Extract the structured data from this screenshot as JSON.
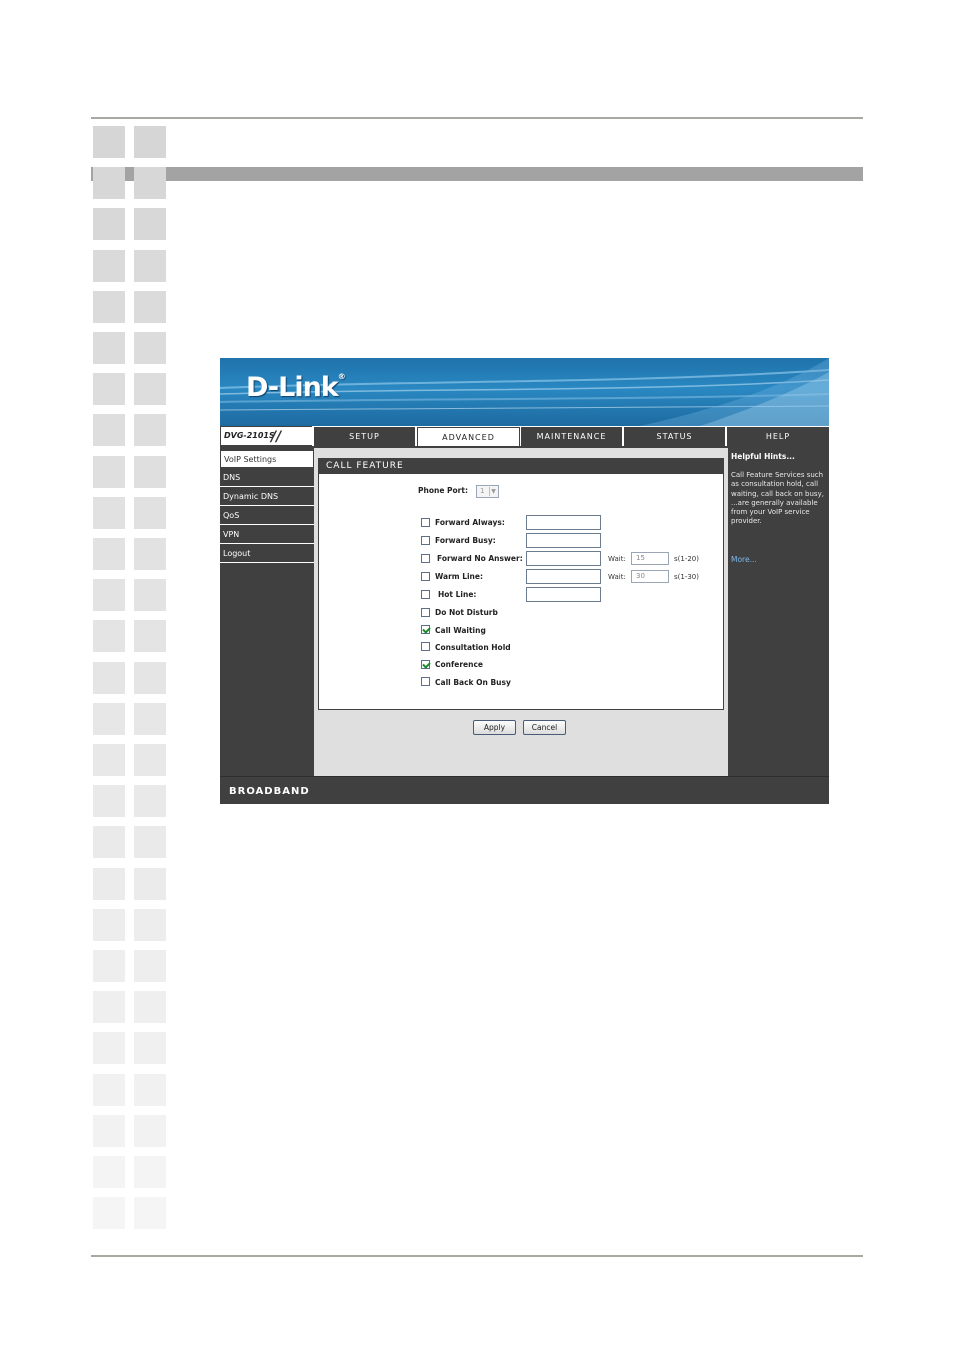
{
  "app": {
    "logo": "D-Link",
    "logo_mark": "®",
    "model": "DVG-2101S",
    "model_slashes": "//",
    "footer": "BROADBAND"
  },
  "tabs": [
    {
      "label": "SETUP"
    },
    {
      "label": "ADVANCED"
    },
    {
      "label": "MAINTENANCE"
    },
    {
      "label": "STATUS"
    },
    {
      "label": "HELP"
    }
  ],
  "sidebar": {
    "items": [
      {
        "label": "VoIP Settings"
      },
      {
        "label": "DNS"
      },
      {
        "label": "Dynamic DNS"
      },
      {
        "label": "QoS"
      },
      {
        "label": "VPN"
      },
      {
        "label": "Logout"
      }
    ]
  },
  "panel": {
    "title": "CALL FEATURE",
    "phone_port_label": "Phone Port:",
    "phone_port_value": "1",
    "features": [
      {
        "label": "Forward Always:",
        "checked": false
      },
      {
        "label": "Forward Busy:",
        "checked": false
      },
      {
        "label": "Forward No Answer:",
        "checked": false
      },
      {
        "label": "Warm Line:",
        "checked": false
      },
      {
        "label": "Hot Line:",
        "checked": false
      },
      {
        "label": "Do Not Disturb",
        "checked": false
      },
      {
        "label": "Call Waiting",
        "checked": true
      },
      {
        "label": "Consultation Hold",
        "checked": false
      },
      {
        "label": "Conference",
        "checked": true
      },
      {
        "label": "Call Back On Busy",
        "checked": false
      }
    ],
    "wait_label": "Wait:",
    "no_answer_wait": "15",
    "no_answer_range": "s(1-20)",
    "warm_line_wait": "30",
    "warm_line_range": "s(1-30)"
  },
  "buttons": {
    "apply": "Apply",
    "cancel": "Cancel"
  },
  "hints": {
    "title": "Helpful Hints...",
    "text": "Call Feature Services such as consultation hold, call waiting, call back on busy, ...are generally available from your VoIP service provider.",
    "more": "More..."
  },
  "colors": {
    "nav_dark": "#404040",
    "banner_blue": "#2a88c2",
    "link_blue": "#7fb8ea",
    "check_green": "#1b8a2a"
  }
}
